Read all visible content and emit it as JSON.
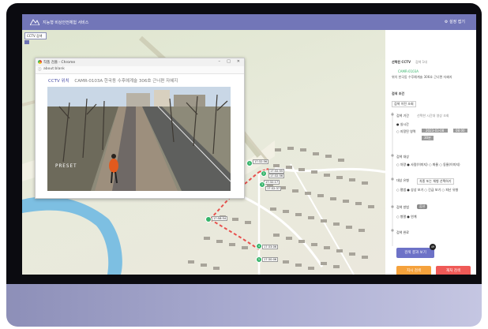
{
  "app": {
    "title": "지능형 비상안전체험 서비스",
    "settings_label": "설정 접기"
  },
  "map": {
    "search_label": "CCTV 검색",
    "track_points": [
      {
        "num": "1",
        "time": "17:32:56"
      },
      {
        "num": "2",
        "time": "17:32:56"
      },
      {
        "num": "3",
        "time": "17:32:37"
      },
      {
        "num": "4",
        "time": "17:33:06"
      },
      {
        "num": "5",
        "time": "17:30:06"
      }
    ],
    "extra_labels": [
      "17:32:55",
      "17:32:17",
      "17:58:54",
      "17:33:06"
    ]
  },
  "popup": {
    "window_title": "작품 검출 - Chrome",
    "url": "about:blank",
    "heading": "CCTV 위치",
    "heading_detail": "CAMR-0103A 한국동 수후예계술 306호 근너편 자혜지",
    "overlay_text": "PRESET"
  },
  "panel": {
    "selected_title": "선택된 CCTV",
    "selected_count": "검색 1대",
    "camera_id": "CAMR-0103A",
    "camera_addr": "위치 한국동 수후예계술 306호 근너편 자혜지",
    "search_condition": "검색 조건",
    "search_option": "검색 이전 조회",
    "period_label": "검색 기간",
    "period_hint": "선택한 시간대 영상 조회",
    "period_opt1": "● 실시간",
    "period_opt2": "○ 지정된 영역",
    "date_value": "2023-03-08",
    "time_value": "08:00",
    "duration_value": "30분",
    "target_label": "검색 대상",
    "target_opts": "○ 차량  ● 사람(이미지)  ○ 화물  ○ 동물(이미지)",
    "feature_label": "대상 유형",
    "feature_hint": "차종 또는 체형 선택하기",
    "feature_opts": "○ 평범  ● 상상 보기  ○ 긴급 보기  ○ 피난 유형",
    "result_label": "검색 방법",
    "result_tag": "옵션",
    "result_opts": "○ 병렬  ● 연계",
    "done_label": "검색 완료",
    "run_button": "검색 결과 보기",
    "run_badge": "49",
    "confirm_button": "지시 검색",
    "cancel_button": "재처 검색"
  },
  "colors": {
    "accent": "#7276b8",
    "route": "#e8504d",
    "marker": "#35b46a",
    "confirm": "#f5a23c",
    "cancel": "#ef5a57"
  }
}
